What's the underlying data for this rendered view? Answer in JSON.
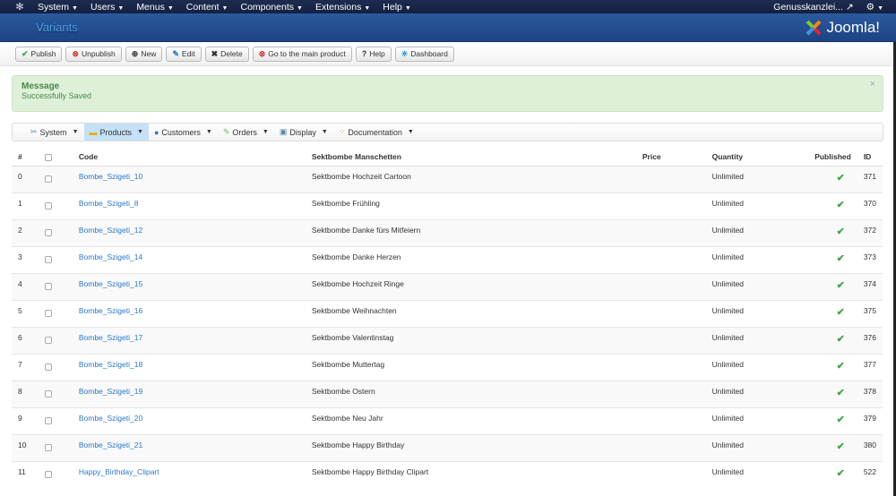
{
  "topbar": {
    "menus": [
      "System",
      "Users",
      "Menus",
      "Content",
      "Components",
      "Extensions",
      "Help"
    ],
    "site": "Genusskanzlei...",
    "logo_icon": "joomla-icon"
  },
  "header": {
    "title": "Variants",
    "brand": "Joomla!"
  },
  "toolbar": [
    "Publish",
    "Unpublish",
    "New",
    "Edit",
    "Delete",
    "Go to the main product",
    "Help",
    "Dashboard"
  ],
  "message": {
    "heading": "Message",
    "text": "Successfully Saved",
    "close": "×"
  },
  "subnav": [
    "System",
    "Products",
    "Customers",
    "Orders",
    "Display",
    "Documentation"
  ],
  "table": {
    "headers": [
      "#",
      "",
      "Code",
      "Sektbombe Manschetten",
      "Price",
      "Quantity",
      "Published",
      "ID"
    ],
    "rows": [
      [
        "0",
        "Bombe_Szigeti_10",
        "Sektbombe Hochzeit Cartoon",
        "",
        "Unlimited",
        "371"
      ],
      [
        "1",
        "Bombe_Szigeti_8",
        "Sektbombe Frühling",
        "",
        "Unlimited",
        "370"
      ],
      [
        "2",
        "Bombe_Szigeti_12",
        "Sektbombe Danke fürs Mitfeiern",
        "",
        "Unlimited",
        "372"
      ],
      [
        "3",
        "Bombe_Szigeti_14",
        "Sektbombe Danke Herzen",
        "",
        "Unlimited",
        "373"
      ],
      [
        "4",
        "Bombe_Szigeti_15",
        "Sektbombe Hochzeit Ringe",
        "",
        "Unlimited",
        "374"
      ],
      [
        "5",
        "Bombe_Szigeti_16",
        "Sektbombe Weihnachten",
        "",
        "Unlimited",
        "375"
      ],
      [
        "6",
        "Bombe_Szigeti_17",
        "Sektbombe Valentinstag",
        "",
        "Unlimited",
        "376"
      ],
      [
        "7",
        "Bombe_Szigeti_18",
        "Sektbombe Muttertag",
        "",
        "Unlimited",
        "377"
      ],
      [
        "8",
        "Bombe_Szigeti_19",
        "Sektbombe Ostern",
        "",
        "Unlimited",
        "378"
      ],
      [
        "9",
        "Bombe_Szigeti_20",
        "Sektbombe Neu Jahr",
        "",
        "Unlimited",
        "379"
      ],
      [
        "10",
        "Bombe_Szigeti_21",
        "Sektbombe Happy Birthday",
        "",
        "Unlimited",
        "380"
      ],
      [
        "11",
        "Happy_Birthday_Clipart",
        "Sektbombe Happy Birthday Clipart",
        "",
        "Unlimited",
        "522"
      ]
    ]
  }
}
